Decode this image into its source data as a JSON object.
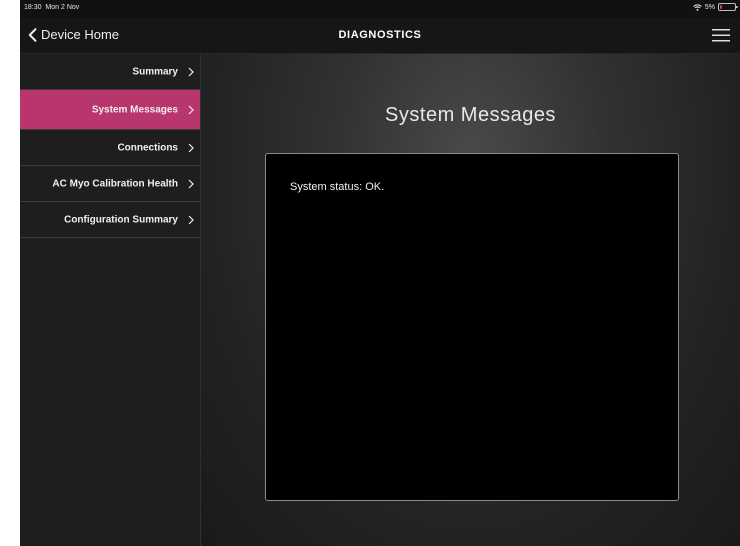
{
  "status_bar": {
    "time": "18:30",
    "date": "Mon 2 Nov",
    "battery": "5%"
  },
  "nav": {
    "back_label": "Device Home",
    "title": "DIAGNOSTICS"
  },
  "sidebar": {
    "items": [
      {
        "label": "Summary",
        "selected": false
      },
      {
        "label": "System Messages",
        "selected": true
      },
      {
        "label": "Connections",
        "selected": false
      },
      {
        "label": "AC Myo Calibration Health",
        "selected": false
      },
      {
        "label": "Configuration Summary",
        "selected": false
      }
    ]
  },
  "main": {
    "title": "System Messages",
    "message": "System status: OK."
  },
  "colors": {
    "accent": "#b8356e",
    "background": "#161616",
    "battery_low": "#e04040"
  },
  "icons": {
    "back": "chevron-left-icon",
    "menu": "hamburger-menu-icon",
    "item_arrow": "chevron-right-icon",
    "wifi": "wifi-icon",
    "battery": "battery-icon"
  }
}
